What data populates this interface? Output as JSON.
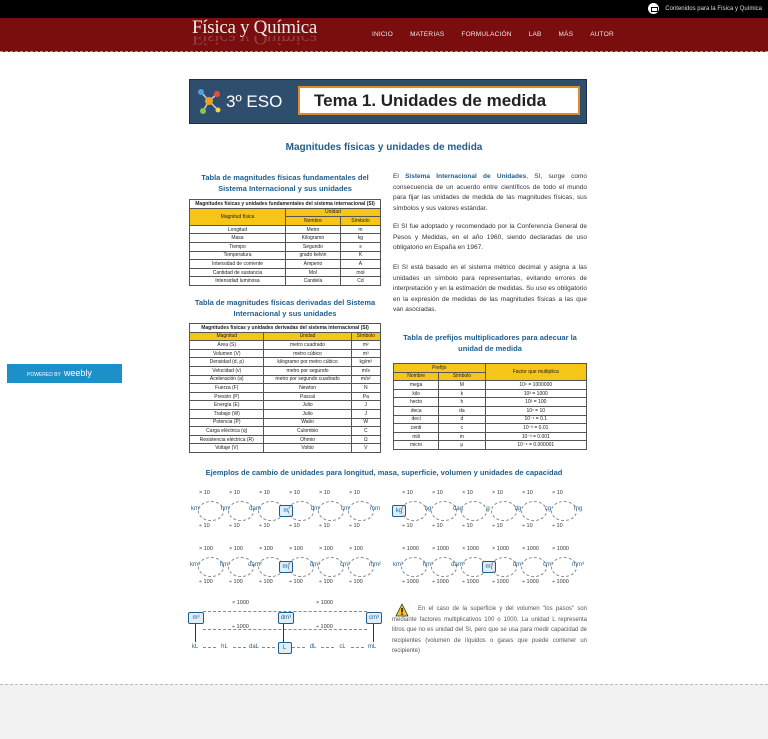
{
  "header": {
    "contact_label": "Contenidos para la Física y Química",
    "logo": "Física y Química",
    "nav": [
      "INICIO",
      "MATERIAS",
      "FORMULACIÓN",
      "LAB",
      "MÁS",
      "AUTOR"
    ]
  },
  "banner": {
    "grade": "3º ESO",
    "title": "Tema 1. Unidades de medida"
  },
  "main_heading": "Magnitudes físicas y unidades de medida",
  "fundamental": {
    "heading": "Tabla de magnitudes físicas fundamentales del Sistema Internacional y sus unidades",
    "caption": "Magnitudes físicas y unidades fundamentales del sistema internacional (SI)",
    "col_magnitud": "Magnitud física",
    "col_unidad": "Unidad",
    "col_nombre": "Nombre",
    "col_simbolo": "Símbolo",
    "rows": [
      [
        "Longitud",
        "Metro",
        "m"
      ],
      [
        "Masa",
        "Kilogramo",
        "kg"
      ],
      [
        "Tiempo",
        "Segundo",
        "s"
      ],
      [
        "Temperatura",
        "grado kelvin",
        "K"
      ],
      [
        "Intensidad de corriente",
        "Amperio",
        "A"
      ],
      [
        "Cantidad de sustancia",
        "Mol",
        "mol"
      ],
      [
        "Intensidad luminosa",
        "Candela",
        "Cd"
      ]
    ]
  },
  "intro": {
    "p1_pre": "El ",
    "p1_bold": "Sistema Internacional de Unidades",
    "p1_post": ", SI, surge como consecuencia de un acuerdo entre científicos de todo el mundo para fijar las unidades de medida de las magnitudes físicas, sus símbolos y sus valores estándar.",
    "p2": "El SI fue adoptado y recomendado por la Conferencia General de Pesos y Medidas, en el año 1960, siendo declaradas de uso obligatorio en España en 1967.",
    "p3": "El SI está basado en el sistema métrico decimal y asigna a las unidades un símbolo para representarlas, evitando errores de interpretación y en la estimación de medidas. Su uso es obligatorio en la expresión de medidas de las magnitudes físicas a las que van asociadas."
  },
  "derived": {
    "heading": "Tabla de magnitudes físicas derivadas del Sistema Internacional y sus unidades",
    "caption": "Magnitudes físicas y unidades derivadas del sistema internacional (SI)",
    "col_magnitud": "Magnitud",
    "col_unidad": "Unidad",
    "col_simbolo": "Símbolo",
    "rows": [
      [
        "Área (S)",
        "metro cuadrado",
        "m²"
      ],
      [
        "Volumen (V)",
        "metro cúbico",
        "m³"
      ],
      [
        "Densidad (d, ρ)",
        "kilogramo por metro cúbico",
        "kg/m³"
      ],
      [
        "Velocidad (v)",
        "metro por segundo",
        "m/s"
      ],
      [
        "Aceleración (a)",
        "metro por segundo cuadrado",
        "m/s²"
      ],
      [
        "Fuerza (F)",
        "Newton",
        "N"
      ],
      [
        "Presión (P)",
        "Pascal",
        "Pa"
      ],
      [
        "Energía (E)",
        "Julio",
        "J"
      ],
      [
        "Trabajo (W)",
        "Julio",
        "J"
      ],
      [
        "Potencia (P)",
        "Watio",
        "W"
      ],
      [
        "Carga eléctrica (q)",
        "Culombio",
        "C"
      ],
      [
        "Resistencia eléctrica (R)",
        "Ohmio",
        "Ω"
      ],
      [
        "Voltaje (V)",
        "Voltio",
        "V"
      ]
    ]
  },
  "prefixes": {
    "heading": "Tabla de prefijos multiplicadores para adecuar la unidad de medida",
    "col_prefijo": "Prefijo",
    "col_nombre": "Nombre",
    "col_simbolo": "Símbolo",
    "col_factor": "Factor que multiplica",
    "rows": [
      [
        "mega",
        "M",
        "10⁶ = 1000000"
      ],
      [
        "kilo",
        "k",
        "10³ = 1000"
      ],
      [
        "hecto",
        "h",
        "10² = 100"
      ],
      [
        "deca",
        "da",
        "10¹ = 10"
      ],
      [
        "deci",
        "d",
        "10⁻¹ = 0.1"
      ],
      [
        "centi",
        "c",
        "10⁻² = 0.01"
      ],
      [
        "mili",
        "m",
        "10⁻³ = 0.001"
      ],
      [
        "micro",
        "μ",
        "10⁻⁶ = 0.000001"
      ]
    ]
  },
  "weebly": {
    "powered": "POWERED BY",
    "brand": "weebly"
  },
  "examples": {
    "heading": "Ejemplos de cambio de unidades para longitud, masa, superficie, volumen y unidades de capacidad",
    "length_units": [
      "km",
      "hm",
      "dam",
      "m",
      "dm",
      "cm",
      "mm"
    ],
    "mass_units": [
      "kg",
      "hg",
      "dag",
      "g",
      "dg",
      "cg",
      "mg"
    ],
    "area_units": [
      "km²",
      "hm²",
      "dam²",
      "m²",
      "dm²",
      "cm²",
      "mm²"
    ],
    "volume_units": [
      "km³",
      "hm³",
      "dam³",
      "m³",
      "dm³",
      "cm³",
      "mm³"
    ],
    "times10": "× 10",
    "div10": "÷ 10",
    "times100": "× 100",
    "div100": "÷ 100",
    "times1000": "× 1000",
    "div1000": "÷ 1000",
    "cap_top": [
      "m³",
      "dm³",
      "cm³"
    ],
    "cap_units": [
      "kL",
      "hL",
      "daL",
      "L",
      "dL",
      "cL",
      "mL"
    ],
    "note": "En el caso de la superficie y del volumen \"los pasos\" son mediante factores multiplicativos 100 o 1000. La unidad L representa litros que no es unidad del SI, pero que se usa para medir capacidad de recipientes (volumen de líquidos o gases que puede contener un recipiente)"
  }
}
